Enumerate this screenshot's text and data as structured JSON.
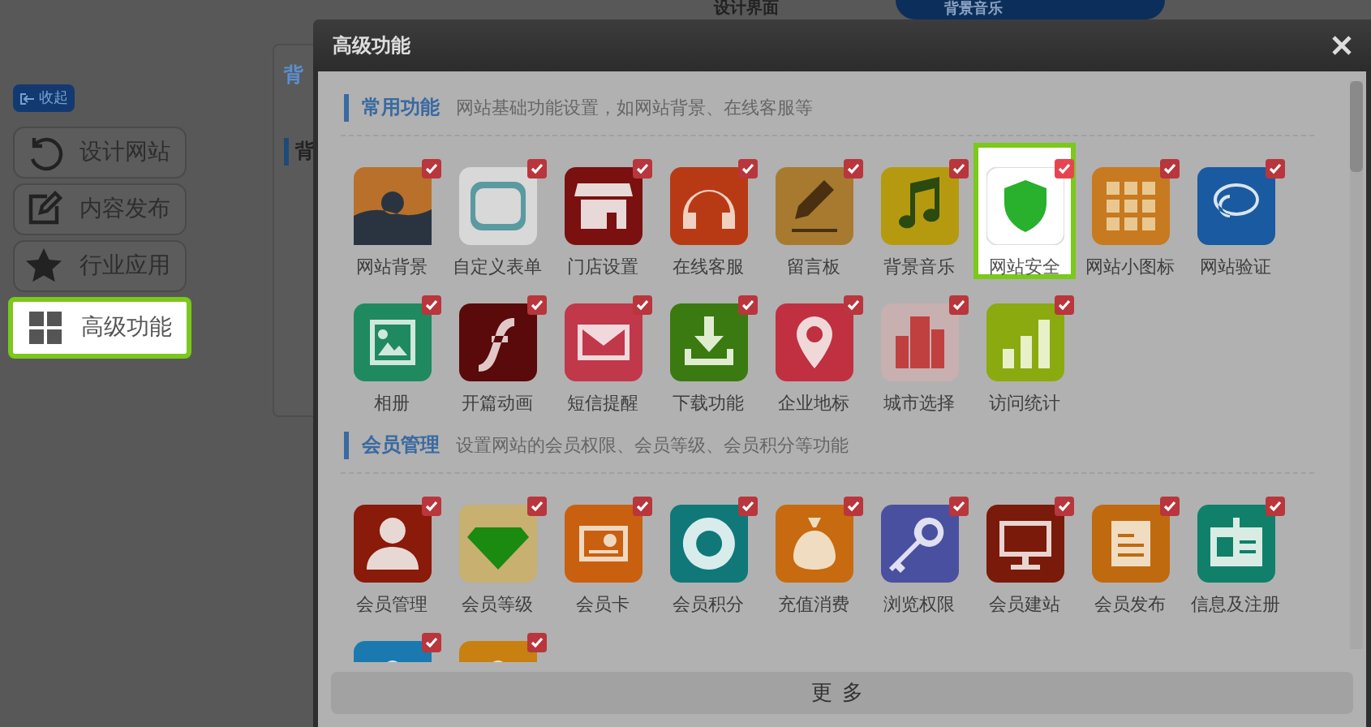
{
  "top_bar": {
    "design_label": "设计界面",
    "music_dropdown": "背景音乐"
  },
  "collapse_button": "收起",
  "sidebar": {
    "items": [
      {
        "label": "设计网站",
        "selected": false
      },
      {
        "label": "内容发布",
        "selected": false
      },
      {
        "label": "行业应用",
        "selected": false
      },
      {
        "label": "高级功能",
        "selected": true
      }
    ]
  },
  "background_panel": {
    "title": "背",
    "tab": "背"
  },
  "dialog": {
    "title": "高级功能",
    "sections": [
      {
        "title": "常用功能",
        "description": "网站基础功能设置，如网站背景、在线客服等",
        "tiles": [
          {
            "label": "网站背景",
            "checked": true,
            "selected": false
          },
          {
            "label": "自定义表单",
            "checked": true,
            "selected": false
          },
          {
            "label": "门店设置",
            "checked": true,
            "selected": false
          },
          {
            "label": "在线客服",
            "checked": true,
            "selected": false
          },
          {
            "label": "留言板",
            "checked": true,
            "selected": false
          },
          {
            "label": "背景音乐",
            "checked": true,
            "selected": false
          },
          {
            "label": "网站安全",
            "checked": true,
            "selected": true
          },
          {
            "label": "网站小图标",
            "checked": true,
            "selected": false
          },
          {
            "label": "网站验证",
            "checked": true,
            "selected": false
          },
          {
            "label": "相册",
            "checked": true,
            "selected": false
          },
          {
            "label": "开篇动画",
            "checked": true,
            "selected": false
          },
          {
            "label": "短信提醒",
            "checked": true,
            "selected": false
          },
          {
            "label": "下载功能",
            "checked": true,
            "selected": false
          },
          {
            "label": "企业地标",
            "checked": true,
            "selected": false
          },
          {
            "label": "城市选择",
            "checked": true,
            "selected": false
          },
          {
            "label": "访问统计",
            "checked": true,
            "selected": false
          }
        ]
      },
      {
        "title": "会员管理",
        "description": "设置网站的会员权限、会员等级、会员积分等功能",
        "tiles": [
          {
            "label": "会员管理",
            "checked": true,
            "selected": false
          },
          {
            "label": "会员等级",
            "checked": true,
            "selected": false
          },
          {
            "label": "会员卡",
            "checked": true,
            "selected": false
          },
          {
            "label": "会员积分",
            "checked": true,
            "selected": false
          },
          {
            "label": "充值消费",
            "checked": true,
            "selected": false
          },
          {
            "label": "浏览权限",
            "checked": true,
            "selected": false
          },
          {
            "label": "会员建站",
            "checked": true,
            "selected": false
          },
          {
            "label": "会员发布",
            "checked": true,
            "selected": false
          },
          {
            "label": "信息及注册",
            "checked": true,
            "selected": false
          },
          {
            "checked": true,
            "selected": false
          },
          {
            "checked": true,
            "selected": false
          }
        ]
      }
    ],
    "more_button": "更多"
  }
}
